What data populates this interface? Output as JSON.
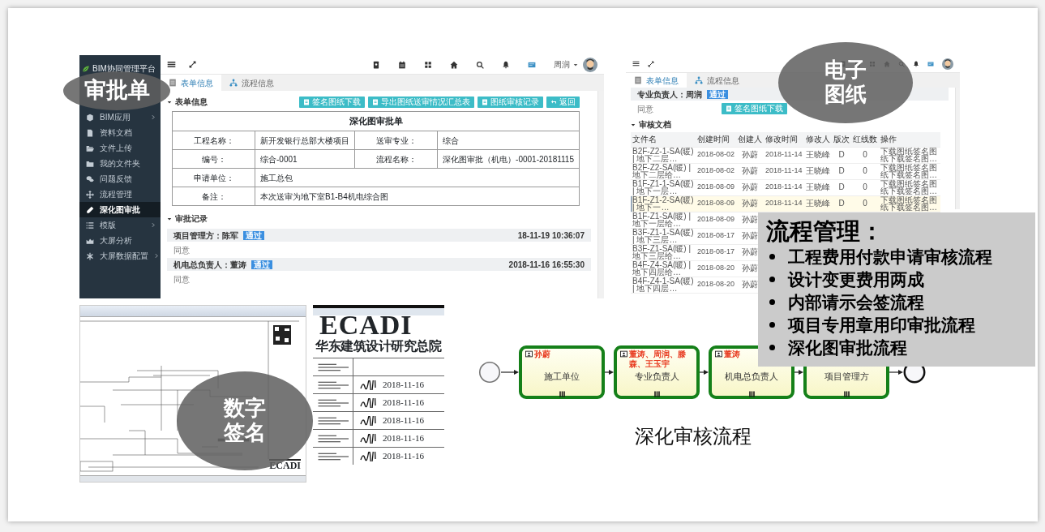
{
  "approval_screenshot": {
    "sidebar": {
      "title": "BIM协同管理平台",
      "items": [
        {
          "label": "BIM应用",
          "expandable": true,
          "selected": false
        },
        {
          "label": "资料文档",
          "expandable": false,
          "selected": false
        },
        {
          "label": "文件上传",
          "expandable": false,
          "selected": false
        },
        {
          "label": "我的文件夹",
          "expandable": false,
          "selected": false
        },
        {
          "label": "问题反馈",
          "expandable": false,
          "selected": false
        },
        {
          "label": "流程管理",
          "expandable": false,
          "selected": false
        },
        {
          "label": "深化图审批",
          "expandable": false,
          "selected": true
        },
        {
          "label": "模版",
          "expandable": true,
          "selected": false
        },
        {
          "label": "大屏分析",
          "expandable": false,
          "selected": false
        },
        {
          "label": "大屏数据配置",
          "expandable": true,
          "selected": false
        }
      ]
    },
    "user": "周润",
    "tabs": [
      {
        "label": "表单信息",
        "selected": true
      },
      {
        "label": "流程信息",
        "selected": false
      }
    ],
    "form_section": "表单信息",
    "buttons": [
      "签名图纸下载",
      "导出图纸送审情况汇总表",
      "图纸审核记录",
      "返回"
    ],
    "form": {
      "title": "深化图审批单",
      "rows": [
        {
          "cells": [
            {
              "text": "工程名称："
            },
            {
              "text": "新开发银行总部大楼项目"
            },
            {
              "text": "送审专业："
            },
            {
              "text": "综合"
            }
          ]
        },
        {
          "cells": [
            {
              "text": "编号："
            },
            {
              "text": "综合-0001"
            },
            {
              "text": "流程名称："
            },
            {
              "text": "深化图审批（机电）-0001-20181115"
            }
          ]
        },
        {
          "cells": [
            {
              "text": "申请单位："
            },
            {
              "text": "施工总包",
              "colspan": 3
            }
          ]
        },
        {
          "cells": [
            {
              "text": "备注："
            },
            {
              "text": "本次送审为地下室B1-B4机电综合图",
              "colspan": 3
            }
          ]
        }
      ]
    },
    "records_section": "审批记录",
    "records": [
      {
        "approver": "项目管理方：陈军",
        "status": "通过",
        "time": "18-11-19 10:36:07",
        "comment": "同意"
      },
      {
        "approver": "机电总负责人：董涛",
        "status": "通过",
        "time": "2018-11-16 16:55:30",
        "comment": "同意"
      }
    ]
  },
  "drawings_screenshot": {
    "tabs": [
      {
        "label": "表单信息",
        "selected": true
      },
      {
        "label": "流程信息",
        "selected": false
      }
    ],
    "record": {
      "approver": "专业负责人：周润",
      "status": "通过",
      "comment": "同意"
    },
    "buttons": [
      "签名图纸下载"
    ],
    "section": "审核文档",
    "columns": [
      "文件名",
      "创建时间",
      "创建人",
      "修改时间",
      "修改人",
      "版次",
      "红线数",
      "操作"
    ],
    "rows": [
      {
        "cells": [
          "B2F-Z2-1-SA(暖) | 地下二层…",
          "2018-08-02",
          "孙蔚",
          "2018-11-14",
          "王晓峰",
          "D",
          "0",
          "下载图纸签名图纸下载签名图…"
        ],
        "selected": false
      },
      {
        "cells": [
          "B2F-Z2-SA(暖) | 地下二层给…",
          "2018-08-02",
          "孙蔚",
          "2018-11-14",
          "王晓峰",
          "D",
          "0",
          "下载图纸签名图纸下载签名图…"
        ],
        "selected": false
      },
      {
        "cells": [
          "B1F-Z1-1-SA(暖) | 地下一层…",
          "2018-08-09",
          "孙蔚",
          "2018-11-14",
          "王晓峰",
          "D",
          "0",
          "下载图纸签名图纸下载签名图…"
        ],
        "selected": false
      },
      {
        "cells": [
          "B1F-Z1-2-SA(暖) | 地下一…",
          "2018-08-09",
          "孙蔚",
          "2018-11-14",
          "王晓峰",
          "D",
          "0",
          "下载图纸签名图纸下载签名图…"
        ],
        "selected": true
      },
      {
        "cells": [
          "B1F-Z1-SA(暖) | 地下一层给…",
          "2018-08-09",
          "孙蔚"
        ],
        "selected": false
      },
      {
        "cells": [
          "B3F-Z1-1-SA(暖) | 地下三层…",
          "2018-08-17",
          "孙蔚"
        ],
        "selected": false
      },
      {
        "cells": [
          "B3F-Z1-SA(暖) | 地下三层给…",
          "2018-08-17",
          "孙蔚"
        ],
        "selected": false
      },
      {
        "cells": [
          "B4F-Z4-SA(暖) | 地下四层给…",
          "2018-08-20",
          "孙蔚"
        ],
        "selected": false
      },
      {
        "cells": [
          "B4F-Z4-1-SA(暖) | 地下四层…",
          "2018-08-20",
          "孙蔚"
        ],
        "selected": false
      }
    ]
  },
  "cad_screenshot": {
    "logo": "ECADI"
  },
  "title_block": {
    "logo": "ECADI",
    "institute": "华东建筑设计研究总院",
    "rows": [
      {
        "signed": false
      },
      {
        "signed": true,
        "date": "2018-11-16"
      },
      {
        "signed": true,
        "date": "2018-11-16"
      },
      {
        "signed": true,
        "date": "2018-11-16"
      },
      {
        "signed": true,
        "date": "2018-11-16"
      },
      {
        "signed": true,
        "date": "2018-11-16"
      }
    ]
  },
  "flow": {
    "tasks": [
      {
        "assignees": "孙蔚",
        "label": "施工单位"
      },
      {
        "assignees": "董涛、周润、滕森、王玉宇",
        "label": "专业负责人"
      },
      {
        "assignees": "董涛",
        "label": "机电总负责人"
      },
      {
        "label": "项目管理方"
      }
    ],
    "caption": "深化审核流程"
  },
  "highlights": [
    {
      "text": "审批单"
    },
    {
      "text": "电子图纸"
    },
    {
      "text": "数字签名"
    }
  ],
  "process_panel": {
    "title": "流程管理：",
    "items": [
      "工程费用付款申请审核流程",
      "设计变更费用两成",
      "内部请示会签流程",
      "项目专用章用印审批流程",
      "深化图审批流程"
    ]
  }
}
